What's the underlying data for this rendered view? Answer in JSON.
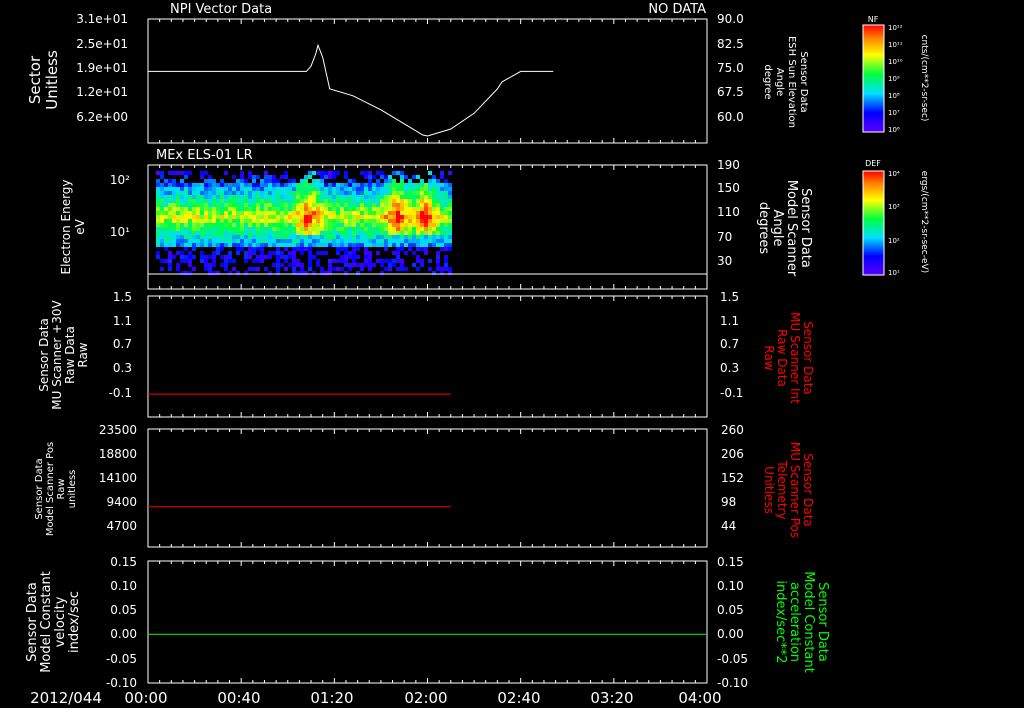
{
  "colors": {
    "background": "#000000",
    "axes": "#ffffff",
    "trace_white": "#ffffff",
    "trace_red": "#ff0000",
    "trace_green": "#00ff00"
  },
  "header": {
    "panel1_title": "NPI Vector Data",
    "panel1_status": "NO DATA",
    "panel2_title": "MEx ELS-01 LR"
  },
  "time_axis": {
    "date": "2012/044",
    "ticks": [
      "00:00",
      "00:40",
      "01:20",
      "02:00",
      "02:40",
      "03:20",
      "04:00"
    ],
    "range_minutes": [
      0,
      240
    ]
  },
  "colorbars": [
    {
      "label": "NF",
      "units": "cnts/(cm**2-sr-sec)",
      "tick_labels": [
        "10¹²",
        "10¹¹",
        "10¹⁰",
        "10⁹",
        "10⁸",
        "10⁷",
        "10⁶"
      ]
    },
    {
      "label": "DEF",
      "units": "ergs/(cm**2-sr-sec-eV)",
      "tick_labels": [
        "10⁴",
        "10³",
        "10²",
        "10¹"
      ]
    }
  ],
  "chart_data": [
    {
      "type": "line",
      "left_axis_label": [
        "Sector",
        "Unitless"
      ],
      "left_ticks": [
        "3.1e+01",
        "2.5e+01",
        "1.9e+01",
        "1.2e+01",
        "6.2e+00"
      ],
      "right_axis_label": [
        "Sensor Data",
        "ESH Sun Elevation",
        "Angle",
        "degree"
      ],
      "right_ticks": [
        "90.0",
        "82.5",
        "75.0",
        "67.5",
        "60.0"
      ],
      "ylim": [
        54.5,
        90
      ],
      "series": [
        {
          "x": [
            0,
            68,
            70,
            72,
            73,
            75,
            78,
            88,
            100,
            110,
            118,
            120,
            130,
            140,
            150,
            152,
            160,
            170,
            174
          ],
          "y": [
            75,
            75,
            76.5,
            80,
            82.5,
            79,
            70,
            68,
            64,
            60,
            56.8,
            56.5,
            58.5,
            63,
            70,
            72,
            75,
            75,
            75
          ]
        }
      ]
    },
    {
      "type": "heatmap",
      "left_axis_label": [
        "Electron Energy",
        "eV"
      ],
      "left_ticks": [
        "10²",
        "10¹"
      ],
      "right_axis_label": [
        "Sensor Data",
        "Model Scanner",
        "Angle",
        "degrees"
      ],
      "right_ticks": [
        "190",
        "150",
        "110",
        "70",
        "30"
      ],
      "x_range_minutes": [
        0,
        130
      ],
      "energy_range_eV": [
        0.7,
        200
      ],
      "baseline_deg": 0,
      "hotspots_minutes": [
        68,
        106,
        118
      ]
    },
    {
      "type": "line",
      "left_axis_label": [
        "Sensor Data",
        "MU Scanner +30V",
        "Raw Data",
        "Raw"
      ],
      "left_ticks": [
        "1.5",
        "1.1",
        "0.7",
        "0.3",
        "-0.1"
      ],
      "right_axis_label": [
        "Sensor Data",
        "MU Scanner Int",
        "Raw Data",
        "Raw"
      ],
      "right_ticks": [
        "1.5",
        "1.1",
        "0.7",
        "0.3",
        "-0.1"
      ],
      "ylim": [
        -0.35,
        1.5
      ],
      "series": [
        {
          "x": [
            0,
            130
          ],
          "y": [
            0,
            0
          ]
        }
      ]
    },
    {
      "type": "line",
      "left_axis_label": [
        "Sensor Data",
        "Model Scanner Pos",
        "Raw",
        "unitless"
      ],
      "left_ticks": [
        "23500",
        "18800",
        "14100",
        "9400",
        "4700"
      ],
      "right_axis_label": [
        "Sensor Data",
        "MU Scanner Pos",
        "Telemetry",
        "Unitless"
      ],
      "right_ticks": [
        "260",
        "206",
        "152",
        "98",
        "44"
      ],
      "ylim": [
        0,
        23500
      ],
      "series": [
        {
          "x": [
            0,
            130
          ],
          "y": [
            8000,
            8000
          ]
        }
      ]
    },
    {
      "type": "line",
      "left_axis_label": [
        "Sensor Data",
        "Model Constant",
        "velocity",
        "index/sec"
      ],
      "left_ticks": [
        "0.15",
        "0.10",
        "0.05",
        "0.00",
        "-0.05",
        "-0.10"
      ],
      "right_axis_label": [
        "Sensor Data",
        "Model Constant",
        "acceleration",
        "index/sec**2"
      ],
      "right_ticks": [
        "0.15",
        "0.10",
        "0.05",
        "0.00",
        "-0.05",
        "-0.10"
      ],
      "ylim": [
        -0.1,
        0.15
      ],
      "series": [
        {
          "x": [
            0,
            240
          ],
          "y": [
            0,
            0
          ]
        }
      ]
    }
  ]
}
